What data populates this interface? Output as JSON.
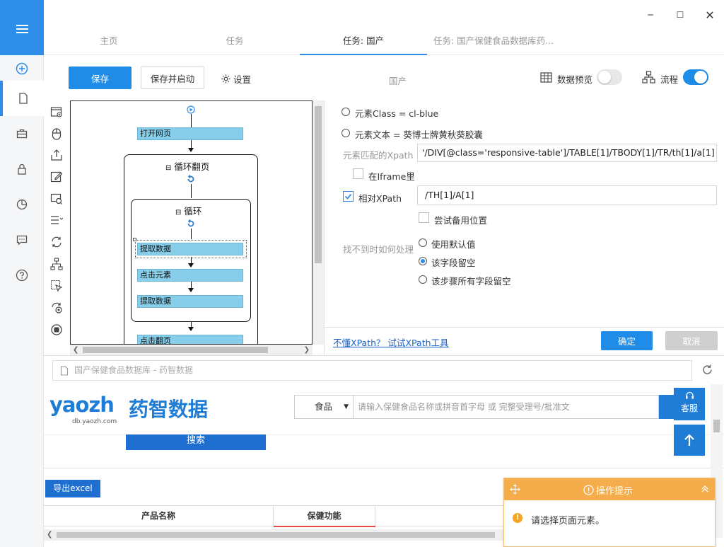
{
  "window": {
    "minimize": "─",
    "maximize": "☐",
    "close": "✕"
  },
  "tabs": [
    {
      "label": "主页"
    },
    {
      "label": "任务"
    },
    {
      "label": "任务: 国产"
    },
    {
      "label": "任务: 国产保健食品数据库药..."
    }
  ],
  "toolbar": {
    "save_label": "保存",
    "save_start_label": "保存并启动",
    "settings_label": "设置",
    "task_name": "国产",
    "preview_label": "数据预览",
    "flow_label": "流程",
    "preview_on": false,
    "flow_on": true
  },
  "flow": {
    "open_page": "打开网页",
    "loop_page": "循环翻页",
    "loop": "循环",
    "extract1": "提取数据",
    "click_el": "点击元素",
    "extract2": "提取数据",
    "next_page": "点击翻页",
    "collapse": "⊟"
  },
  "config": {
    "opt_class": "元素Class = cl-blue",
    "opt_text": "元素文本 = 葵博士牌黄秋葵胶囊",
    "xpath_label": "元素匹配的Xpath",
    "xpath_value": "'/DIV[@class='responsive-table']/TABLE[1]/TBODY[1]/TR/th[1]/a[1]",
    "iframe_label": "在Iframe里",
    "rel_xpath_label": "相对XPath",
    "rel_xpath_value": "/TH[1]/A[1]",
    "backup_label": "尝试备用位置",
    "notfound_label": "找不到时如何处理",
    "nf_opt1": "使用默认值",
    "nf_opt2": "该字段留空",
    "nf_opt3": "该步骤所有字段留空",
    "help_link": "不懂XPath？ 试试XPath工具",
    "ok_label": "确定",
    "cancel_label": "取消"
  },
  "browser": {
    "url": "国产保健食品数据库 - 药智数据",
    "logo_text": "yaozh",
    "logo_cn": "药智数据",
    "logo_domain": "db.yaozh.com",
    "category": "食品",
    "search_placeholder": "请输入保健食品名称或拼音首字母  或  完整受理号/批准文",
    "service_label": "客服",
    "search_btn": "搜索",
    "export_btn": "导出excel",
    "col_name": "产品名称",
    "col_func": "保健功能"
  },
  "hint": {
    "title": "操作提示",
    "message": "请选择页面元素。"
  },
  "colors": {
    "accent": "#1f8ce8",
    "hint_orange": "#f5ad4b",
    "step_blue": "#87ceeb"
  }
}
